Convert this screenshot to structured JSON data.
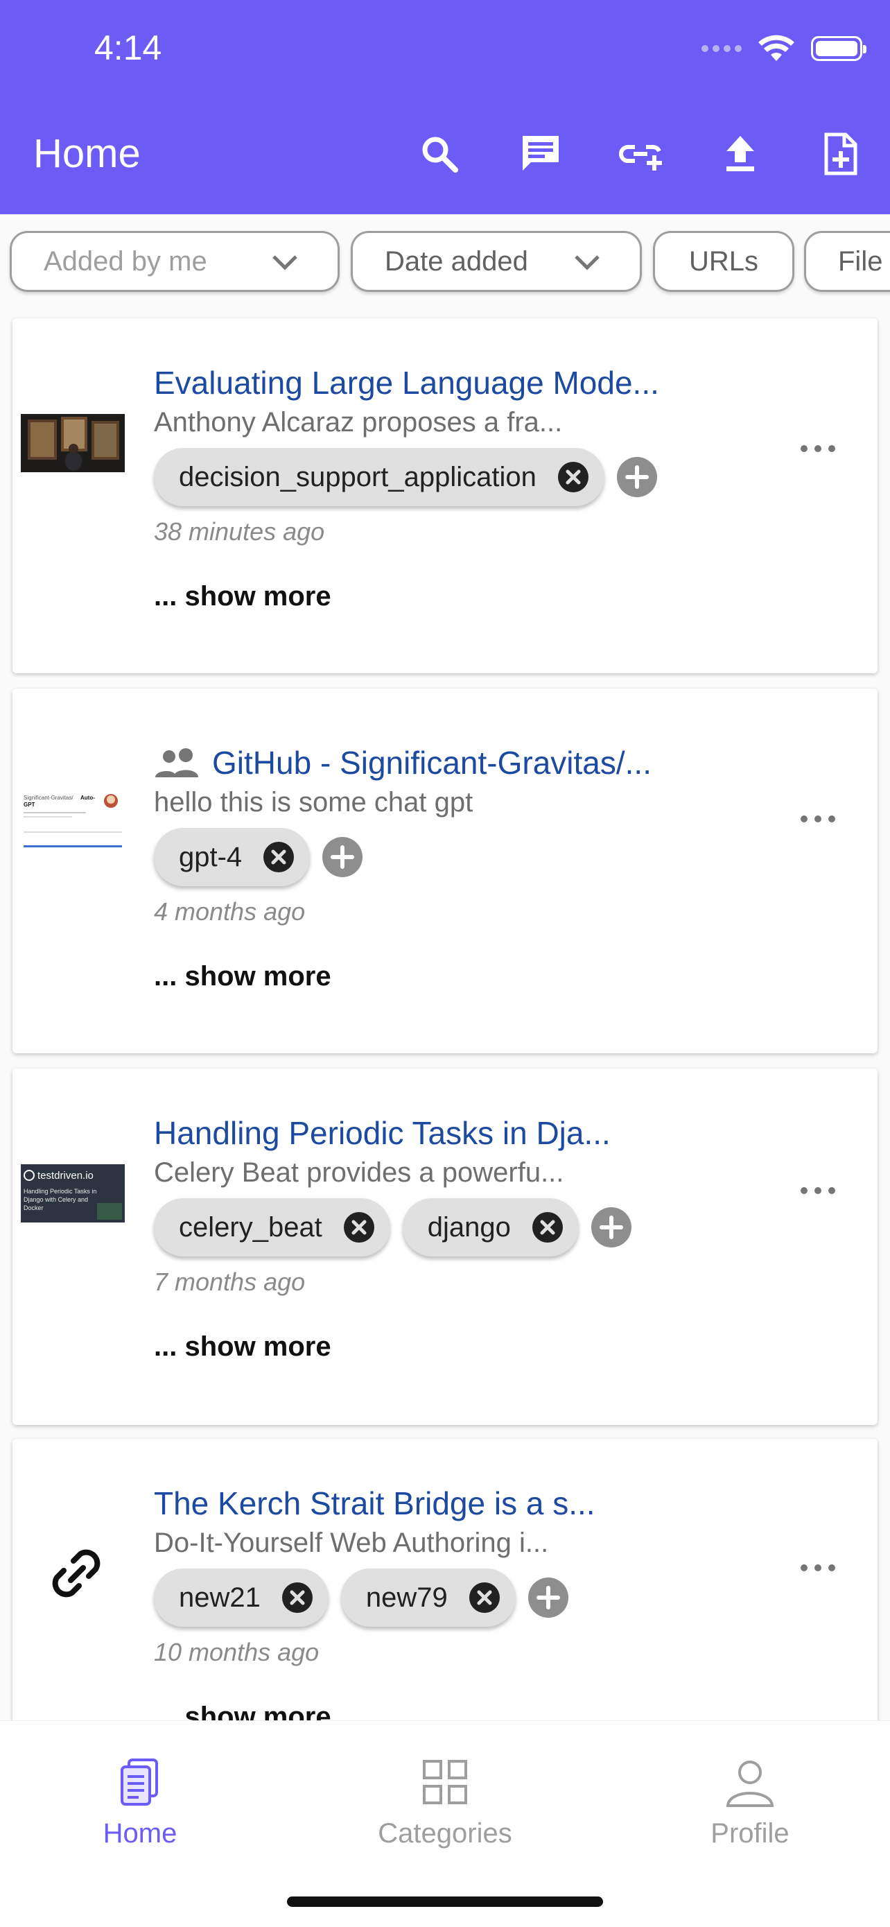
{
  "status_bar": {
    "time": "4:14"
  },
  "app_bar": {
    "title": "Home"
  },
  "filters": [
    {
      "label": "Added by me",
      "has_dropdown": true
    },
    {
      "label": "Date added",
      "has_dropdown": true
    },
    {
      "label": "URLs",
      "has_dropdown": false
    },
    {
      "label": "File",
      "has_dropdown": false
    }
  ],
  "cards": [
    {
      "title": "Evaluating Large Language Mode...",
      "subtitle": "Anthony Alcaraz proposes a fra...",
      "tags": [
        "decision_support_application"
      ],
      "time": "38 minutes ago",
      "show_more": "... show more",
      "shared": false,
      "thumbnail": "painting-thumbnail"
    },
    {
      "title": "GitHub - Significant-Gravitas/...",
      "subtitle": "hello this is some chat gpt",
      "tags": [
        "gpt-4"
      ],
      "time": "4 months ago",
      "show_more": "... show more",
      "shared": true,
      "thumbnail": "github-thumbnail"
    },
    {
      "title": "Handling Periodic Tasks in Dja...",
      "subtitle": "Celery Beat provides a powerfu...",
      "tags": [
        "celery_beat",
        "django"
      ],
      "time": "7 months ago",
      "show_more": "... show more",
      "shared": false,
      "thumbnail": "testdriven-thumbnail"
    },
    {
      "title": "The Kerch Strait Bridge is a s...",
      "subtitle": "Do-It-Yourself Web Authoring i...",
      "tags": [
        "new21",
        "new79"
      ],
      "time": "10 months ago",
      "show_more": "... show more",
      "shared": false,
      "thumbnail": "link-icon"
    }
  ],
  "thumb_text": {
    "github_title_a": "Significant-Gravitas/",
    "github_title_b": "Auto-",
    "github_title_c": "GPT",
    "testdriven_brand": "testdriven.io",
    "testdriven_line1": "Handling Periodic Tasks in",
    "testdriven_line2": "Django with Celery and",
    "testdriven_line3": "Docker"
  },
  "bottom_nav": [
    {
      "label": "Home",
      "active": true
    },
    {
      "label": "Categories",
      "active": false
    },
    {
      "label": "Profile",
      "active": false
    }
  ],
  "colors": {
    "primary": "#6b5cf5",
    "link": "#1c4aa0",
    "tag_bg": "#e0e0e0",
    "inactive_nav": "#9e9e9e"
  }
}
